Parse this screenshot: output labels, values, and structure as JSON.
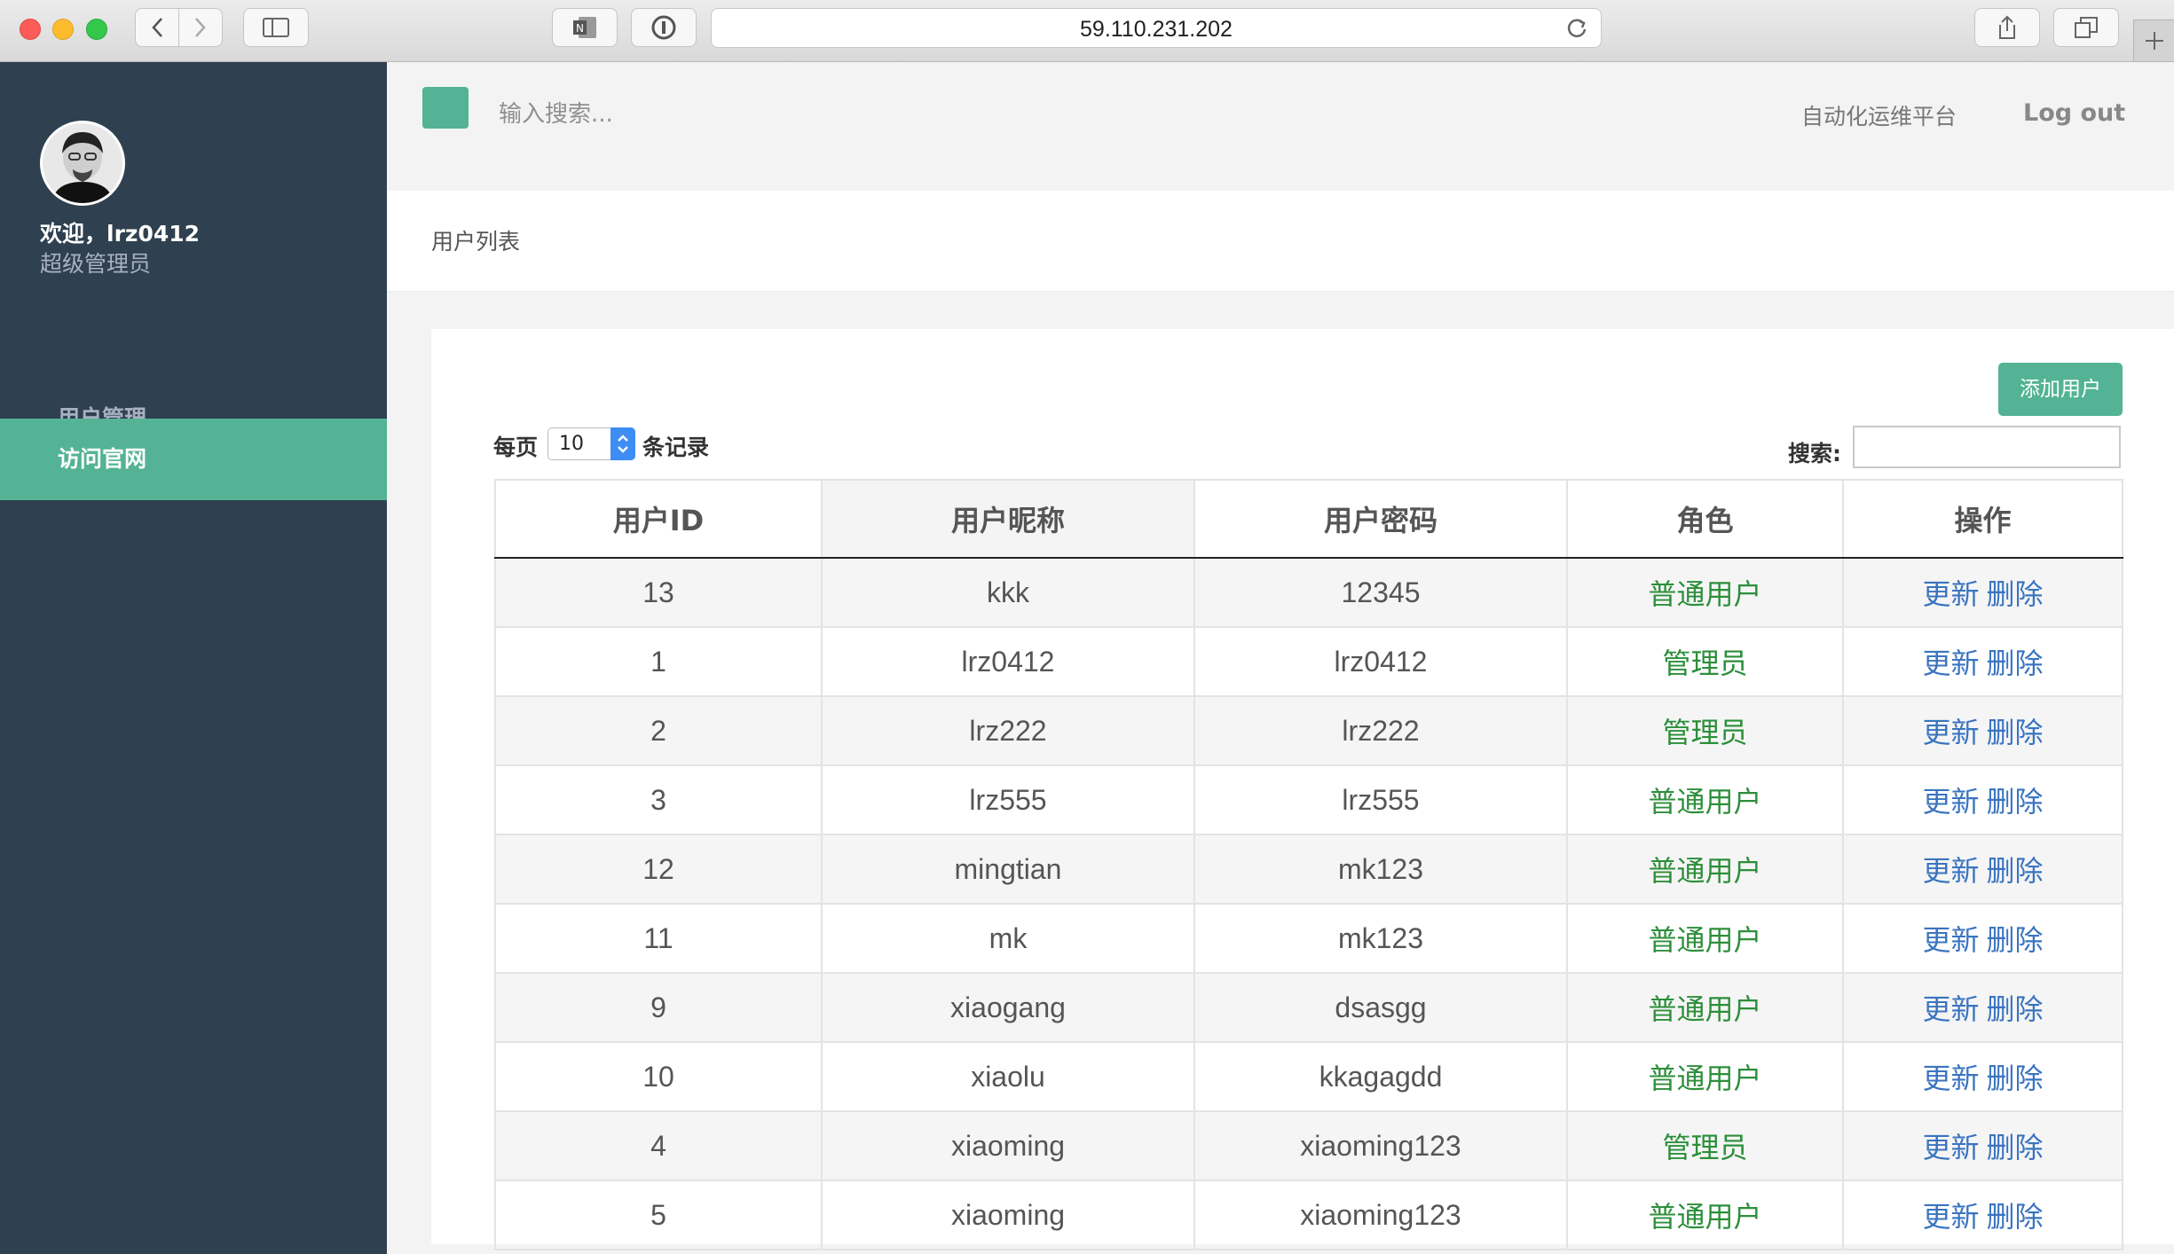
{
  "browser": {
    "url": "59.110.231.202"
  },
  "sidebar": {
    "welcome": "欢迎，lrz0412",
    "role": "超级管理员",
    "items": [
      {
        "label": "用户管理",
        "active": false
      },
      {
        "label": "访问官网",
        "active": true
      }
    ]
  },
  "topbar": {
    "search_placeholder": "输入搜索...",
    "platform": "自动化运维平台",
    "logout": "Log out"
  },
  "page": {
    "title": "用户列表"
  },
  "table_controls": {
    "add_user": "添加用户",
    "per_page_prefix": "每页",
    "per_page_value": "10",
    "per_page_suffix": "条记录",
    "search_label": "搜索:"
  },
  "table": {
    "columns": [
      "用户ID",
      "用户昵称",
      "用户密码",
      "角色",
      "操作"
    ],
    "rows": [
      {
        "id": "13",
        "nickname": "kkk",
        "password": "12345",
        "role": "普通用户"
      },
      {
        "id": "1",
        "nickname": "lrz0412",
        "password": "lrz0412",
        "role": "管理员"
      },
      {
        "id": "2",
        "nickname": "lrz222",
        "password": "lrz222",
        "role": "管理员"
      },
      {
        "id": "3",
        "nickname": "lrz555",
        "password": "lrz555",
        "role": "普通用户"
      },
      {
        "id": "12",
        "nickname": "mingtian",
        "password": "mk123",
        "role": "普通用户"
      },
      {
        "id": "11",
        "nickname": "mk",
        "password": "mk123",
        "role": "普通用户"
      },
      {
        "id": "9",
        "nickname": "xiaogang",
        "password": "dsasgg",
        "role": "普通用户"
      },
      {
        "id": "10",
        "nickname": "xiaolu",
        "password": "kkagagdd",
        "role": "普通用户"
      },
      {
        "id": "4",
        "nickname": "xiaoming",
        "password": "xiaoming123",
        "role": "管理员"
      },
      {
        "id": "5",
        "nickname": "xiaoming",
        "password": "xiaoming123",
        "role": "普通用户"
      }
    ],
    "update_label": "更新",
    "delete_label": "删除"
  },
  "colors": {
    "sidebar_bg": "#2f4050",
    "accent": "#53b394",
    "role_text": "#2c8f3a",
    "link": "#3a74c0"
  }
}
